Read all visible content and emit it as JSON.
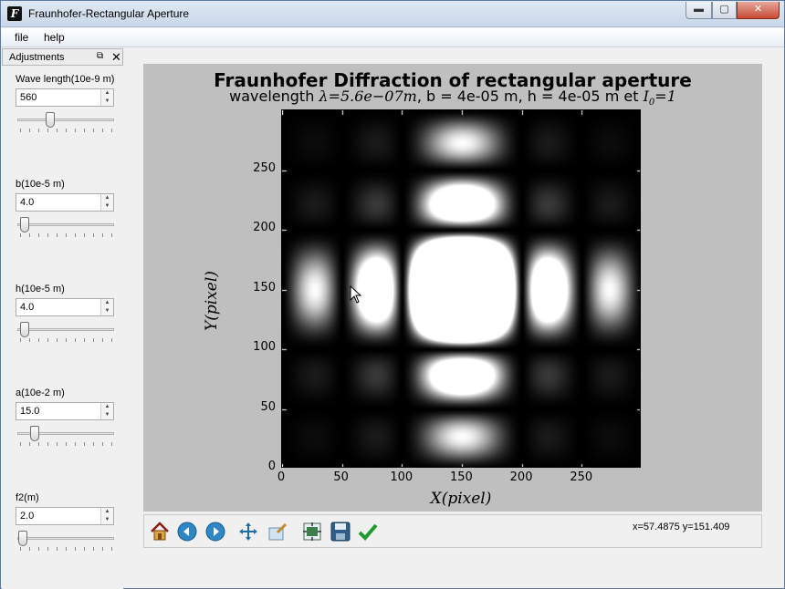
{
  "window": {
    "title": "Fraunhofer-Rectangular Aperture"
  },
  "menu": {
    "items": [
      "file",
      "help"
    ]
  },
  "dock": {
    "title": "Adjustments"
  },
  "params": [
    {
      "label": "Wave length(10e-9 m)",
      "value": "560",
      "slider_fraction": 0.32
    },
    {
      "label": "b(10e-5 m)",
      "value": "4.0",
      "slider_fraction": 0.03
    },
    {
      "label": "h(10e-5 m)",
      "value": "4.0",
      "slider_fraction": 0.03
    },
    {
      "label": "a(10e-2 m)",
      "value": "15.0",
      "slider_fraction": 0.15
    },
    {
      "label": "f2(m)",
      "value": "2.0",
      "slider_fraction": 0.01
    }
  ],
  "plot": {
    "title": "Fraunhofer Diffraction of rectangular aperture",
    "subtitle_prefix": "wavelength ",
    "subtitle_math1": "λ=5.6e−07m",
    "subtitle_mid": ", b = 4e-05 m, h = 4e-05 m et ",
    "subtitle_math2": "I",
    "subtitle_math2_sub": "0",
    "subtitle_math2_rest": "=1"
  },
  "toolbar": {
    "icons": [
      "home-icon",
      "back-icon",
      "forward-icon",
      "pan-icon",
      "zoom-icon",
      "configure-subplots-icon",
      "save-icon",
      "check-icon"
    ],
    "coords": "x=57.4875     y=151.409"
  },
  "chart_data": {
    "type": "heatmap",
    "title": "Fraunhofer Diffraction of rectangular aperture",
    "xlabel": "X(pixel)",
    "ylabel": "Y(pixel)",
    "xlim": [
      0,
      300
    ],
    "ylim": [
      0,
      300
    ],
    "xticks": [
      0,
      50,
      100,
      150,
      200,
      250
    ],
    "yticks": [
      0,
      50,
      100,
      150,
      200,
      250
    ],
    "colormap": "gray",
    "center": [
      150,
      150
    ],
    "lobe_period_px": 50
  }
}
